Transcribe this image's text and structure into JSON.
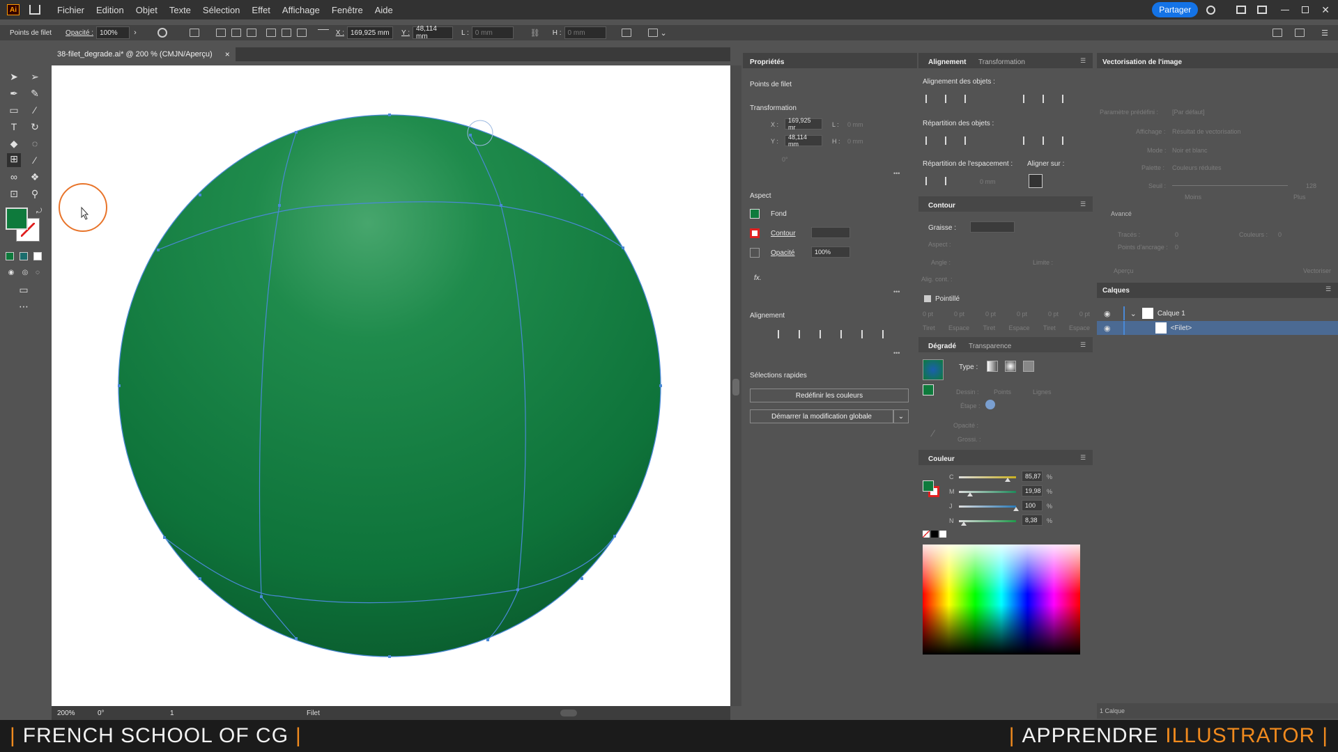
{
  "menubar": {
    "items": [
      "Fichier",
      "Edition",
      "Objet",
      "Texte",
      "Sélection",
      "Effet",
      "Affichage",
      "Fenêtre",
      "Aide"
    ],
    "share": "Partager",
    "logo": "Ai"
  },
  "ctrl": {
    "context": "Points de filet",
    "opacity_label": "Opacité :",
    "opacity_value": "100%",
    "x_label": "X :",
    "x_value": "169,925 mm",
    "y_label": "Y :",
    "y_value": "48,114 mm",
    "l_label": "L :",
    "l_value": "0 mm",
    "h_label": "H :",
    "h_value": "0 mm"
  },
  "doc": {
    "tab_title": "38-filet_degrade.ai* @ 200 % (CMJN/Aperçu)",
    "close": "×"
  },
  "status": {
    "zoom": "200%",
    "rotation": "0°",
    "artboard": "1",
    "tool": "Filet"
  },
  "properties": {
    "tab": "Propriétés",
    "context": "Points de filet",
    "transform_title": "Transformation",
    "x_label": "X :",
    "x_value": "169,925 mr",
    "y_label": "Y :",
    "y_value": "48,114 mm",
    "l_label": "L :",
    "l_value": "0 mm",
    "h_label": "H :",
    "h_value": "0 mm",
    "angle_value": "0°",
    "aspect_title": "Aspect",
    "fill_label": "Fond",
    "stroke_label": "Contour",
    "opacity_label": "Opacité",
    "opacity_value": "100%",
    "fx": "fx.",
    "align_title": "Alignement",
    "quick_title": "Sélections rapides",
    "btn_redefine": "Redéfinir les couleurs",
    "btn_global": "Démarrer la modification globale"
  },
  "align_panel": {
    "tab1": "Alignement",
    "tab2": "Transformation",
    "objects": "Alignement des objets :",
    "distribute": "Répartition des objets :",
    "spacing": "Répartition de l'espacement :",
    "align_to": "Aligner sur :",
    "spacing_value": "0 mm"
  },
  "contour": {
    "title": "Contour",
    "weight": "Graisse :",
    "aspect": "Aspect :",
    "angle": "Angle :",
    "limit": "Limite :",
    "align": "Alig. cont. :",
    "dashed": "Pointillé",
    "dash_values": [
      "0 pt",
      "0 pt",
      "0 pt",
      "0 pt",
      "0 pt",
      "0 pt"
    ],
    "dash_labels": [
      "Tiret",
      "Espace",
      "Tiret",
      "Espace",
      "Tiret",
      "Espace"
    ]
  },
  "gradient": {
    "tab1": "Dégradé",
    "tab2": "Transparence",
    "type": "Type :",
    "drawing": "Dessin :",
    "points": "Points",
    "lines": "Lignes",
    "step": "Étape :",
    "opacity": "Opacité :",
    "size": "Grossi. :"
  },
  "color": {
    "title": "Couleur",
    "channels": [
      {
        "label": "C",
        "value": "85,87",
        "pct": "%",
        "level": 0.8587,
        "color": "#c9b020"
      },
      {
        "label": "M",
        "value": "19,98",
        "pct": "%",
        "level": 0.1998,
        "color": "#1d8a5a"
      },
      {
        "label": "J",
        "value": "100",
        "pct": "%",
        "level": 1.0,
        "color": "#2a7ab8"
      },
      {
        "label": "N",
        "value": "8,38",
        "pct": "%",
        "level": 0.0838,
        "color": "#1e9a4a"
      }
    ]
  },
  "vector": {
    "title": "Vectorisation de l'image",
    "preset": "Paramètre prédéfini :",
    "preset_value": "[Par défaut]",
    "display": "Affichage :",
    "display_value": "Résultat de vectorisation",
    "mode": "Mode :",
    "mode_value": "Noir et blanc",
    "palette": "Palette :",
    "palette_value": "Couleurs réduites",
    "threshold": "Seuil :",
    "threshold_value": "128",
    "less": "Moins",
    "more": "Plus",
    "advanced": "Avancé",
    "paths": "Tracés :",
    "paths_value": "0",
    "colors": "Couleurs :",
    "colors_value": "0",
    "anchors": "Points d'ancrage :",
    "anchors_value": "0",
    "preview": "Aperçu",
    "vectorize": "Vectoriser"
  },
  "layers": {
    "title": "Calques",
    "layer1": "Calque 1",
    "sublayer": "<Filet>",
    "count": "1 Calque"
  },
  "footer": {
    "left_sep": "|",
    "left": "FRENCH SCHOOL OF CG",
    "right_sep": "|",
    "right1": "APPRENDRE",
    "right2": "ILLUSTRATOR"
  }
}
